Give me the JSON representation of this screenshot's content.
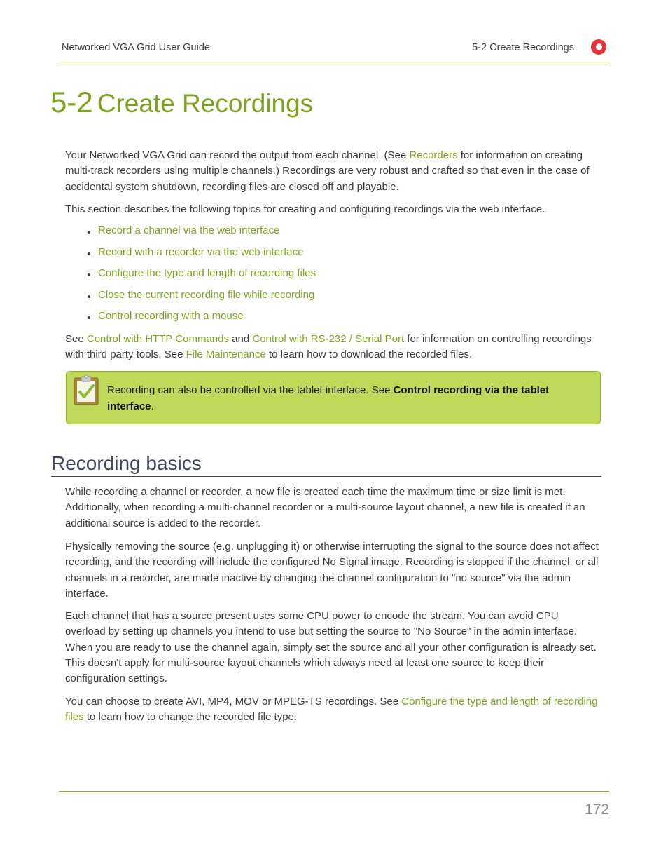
{
  "header": {
    "guide_title": "Networked VGA Grid User Guide",
    "section_title": "5-2 Create Recordings",
    "icon": "record-icon",
    "accent_color": "#8aa628",
    "icon_color": "#e8323c"
  },
  "title": {
    "number": "5-2",
    "text": "Create Recordings"
  },
  "intro": {
    "p1_before": "Your Networked VGA Grid can record the output from each channel. (See ",
    "p1_link": "Recorders",
    "p1_after": " for information on creating multi-track recorders using multiple channels.) Recordings are very robust and crafted so that even in the case of accidental system shutdown, recording files are closed off and playable.",
    "p2": "This section describes the following topics for creating and configuring recordings via the web interface."
  },
  "topics": [
    "Record a channel via the web interface",
    "Record with a recorder via the web interface",
    "Configure the type and length of recording files",
    "Close the current recording file while recording",
    "Control recording with a mouse"
  ],
  "see_also": {
    "t1": "See ",
    "link1": "Control with HTTP Commands",
    "t2": " and ",
    "link2": "Control with RS-232 / Serial Port",
    "t3": " for information on controlling recordings with third party tools. See ",
    "link3": "File Maintenance",
    "t4": " to learn how to download the recorded files."
  },
  "note": {
    "icon": "clipboard-check-icon",
    "text": "Recording can also be controlled via the tablet interface. See ",
    "bold": "Control recording via the tablet interface",
    "end": ".",
    "bg_color": "#bfd85a"
  },
  "basics": {
    "heading": "Recording basics",
    "p1": "While recording a channel or recorder, a new file is created each time the maximum time or size limit is met. Additionally, when recording a multi-channel recorder or a multi-source layout channel, a new file is created if an additional source is added to the recorder.",
    "p2": "Physically removing the source (e.g. unplugging it) or otherwise interrupting the signal to the source does not affect recording, and the recording will include the configured No Signal image. Recording is stopped if the channel, or all channels in a recorder, are made inactive by changing the channel configuration to \"no source\" via the admin interface.",
    "p3": "Each channel that has a source present uses some CPU power to encode the stream. You can avoid CPU overload by setting up channels you intend to use but setting the source to \"No Source\" in the admin interface. When you are ready to use the channel again, simply set the source and all your other configuration is already set. This doesn't apply for multi-source layout channels which always need at least one source to keep their configuration settings.",
    "p4_before": "You can choose to create AVI, MP4, MOV or MPEG-TS recordings. See ",
    "p4_link": "Configure the type and length of recording files",
    "p4_after": " to learn how to change the recorded file type."
  },
  "footer": {
    "page_number": "172"
  }
}
